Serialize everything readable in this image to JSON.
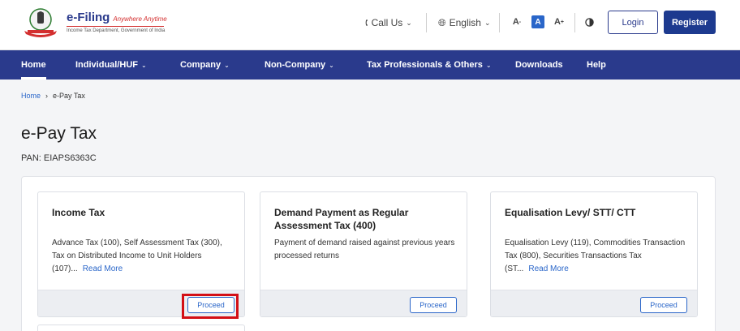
{
  "brand": {
    "name": "e-Filing",
    "tagline": "Anywhere Anytime",
    "subtitle": "Income Tax Department, Government of India"
  },
  "header": {
    "call_us": "Call Us",
    "language": "English",
    "font_decrease": "A",
    "font_normal": "A",
    "font_increase": "A",
    "login": "Login",
    "register": "Register"
  },
  "nav": {
    "items": [
      {
        "label": "Home",
        "active": true
      },
      {
        "label": "Individual/HUF"
      },
      {
        "label": "Company"
      },
      {
        "label": "Non-Company"
      },
      {
        "label": "Tax Professionals & Others"
      },
      {
        "label": "Downloads"
      },
      {
        "label": "Help"
      }
    ]
  },
  "breadcrumb": {
    "home": "Home",
    "separator": "›",
    "current": "e-Pay Tax"
  },
  "page": {
    "title": "e-Pay Tax",
    "pan": "PAN: EIAPS6363C"
  },
  "cards": [
    {
      "title": "Income Tax",
      "description": "Advance Tax (100), Self Assessment Tax (300), Tax on Distributed Income to Unit Holders (107)...",
      "read_more": "Read More",
      "button": "Proceed"
    },
    {
      "title": "Demand Payment as Regular Assessment Tax (400)",
      "description": "Payment of demand raised against previous years processed returns",
      "read_more": "",
      "button": "Proceed"
    },
    {
      "title": "Equalisation Levy/ STT/ CTT",
      "description": "Equalisation Levy (119), Commodities Transaction Tax (800), Securities Transactions Tax (ST...",
      "read_more": "Read More",
      "button": "Proceed"
    }
  ],
  "colors": {
    "nav_bg": "#2a3a8c",
    "accent": "#2a66c9",
    "highlight": "#d30f16"
  }
}
